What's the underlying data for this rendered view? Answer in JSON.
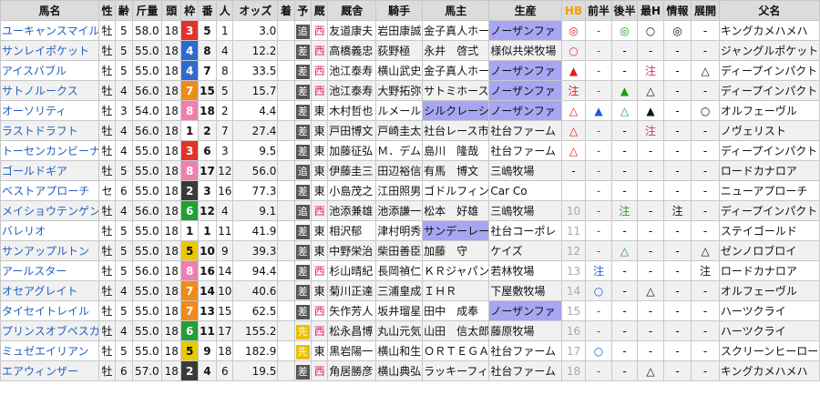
{
  "headers": [
    "馬名",
    "性",
    "齢",
    "斤量",
    "頭",
    "枠",
    "番",
    "人",
    "オッズ",
    "着",
    "予",
    "厩",
    "厩舎",
    "騎手",
    "馬主",
    "生産",
    "HB",
    "前半",
    "後半",
    "最H",
    "情報",
    "展開",
    "父名"
  ],
  "waku_colors": {
    "1": "#ffffff",
    "2": "#3a3a3a",
    "3": "#e2332b",
    "4": "#2e6ad0",
    "5": "#e9c900",
    "6": "#22a035",
    "7": "#f08a1a",
    "8": "#f07fb0"
  },
  "rows": [
    {
      "name": "ユーキャンスマイル",
      "sex": "牡",
      "age": "5",
      "weight": "58.0",
      "heads": "18",
      "waku": "3",
      "ban": "5",
      "pop": "1",
      "odds": "3.0",
      "chaku": "",
      "yoso": "追",
      "yoso_type": "t2",
      "ewest": "西",
      "trainer": "友道康夫",
      "jockey": "岩田康誠",
      "owner": "金子真人ホー",
      "owner_hl": false,
      "breeder": "ノーザンファ",
      "breeder_hl": true,
      "hb": "◎",
      "hb_c": "red",
      "front": "-",
      "back": "◎",
      "back_c": "grn",
      "maxh": "○",
      "maxh_c": "",
      "info": "◎",
      "info_c": "",
      "tenkai": "-",
      "sire": "キングカメハメハ"
    },
    {
      "name": "サンレイポケット",
      "sex": "牡",
      "age": "5",
      "weight": "55.0",
      "heads": "18",
      "waku": "4",
      "ban": "8",
      "pop": "4",
      "odds": "12.2",
      "chaku": "",
      "yoso": "差",
      "yoso_type": "t1",
      "ewest": "西",
      "trainer": "高橋義忠",
      "jockey": "荻野極",
      "owner": "永井　啓弍",
      "owner_hl": false,
      "breeder": "様似共栄牧場",
      "breeder_hl": false,
      "hb": "○",
      "hb_c": "pink",
      "front": "-",
      "back": "-",
      "back_c": "",
      "maxh": "-",
      "maxh_c": "",
      "info": "-",
      "info_c": "",
      "tenkai": "-",
      "sire": "ジャングルポケット"
    },
    {
      "name": "アイスバブル",
      "sex": "牡",
      "age": "5",
      "weight": "55.0",
      "heads": "18",
      "waku": "4",
      "ban": "7",
      "pop": "8",
      "odds": "33.5",
      "chaku": "",
      "yoso": "差",
      "yoso_type": "t1",
      "ewest": "西",
      "trainer": "池江泰寿",
      "jockey": "横山武史",
      "owner": "金子真人ホー",
      "owner_hl": false,
      "breeder": "ノーザンファ",
      "breeder_hl": true,
      "hb": "▲",
      "hb_c": "red",
      "front": "-",
      "back": "-",
      "back_c": "",
      "maxh": "注",
      "maxh_c": "pink",
      "info": "-",
      "info_c": "",
      "tenkai": "△",
      "sire": "ディープインパクト"
    },
    {
      "name": "サトノルークス",
      "sex": "牡",
      "age": "4",
      "weight": "56.0",
      "heads": "18",
      "waku": "7",
      "ban": "15",
      "pop": "5",
      "odds": "15.7",
      "chaku": "",
      "yoso": "差",
      "yoso_type": "t1",
      "ewest": "西",
      "trainer": "池江泰寿",
      "jockey": "大野拓弥",
      "owner": "サトミホース",
      "owner_hl": false,
      "breeder": "ノーザンファ",
      "breeder_hl": true,
      "hb": "注",
      "hb_c": "red",
      "front": "-",
      "back": "▲",
      "back_c": "grn",
      "maxh": "△",
      "maxh_c": "",
      "info": "-",
      "info_c": "",
      "tenkai": "-",
      "sire": "ディープインパクト"
    },
    {
      "name": "オーソリティ",
      "sex": "牡",
      "age": "3",
      "weight": "54.0",
      "heads": "18",
      "waku": "8",
      "ban": "18",
      "pop": "2",
      "odds": "4.4",
      "chaku": "",
      "yoso": "差",
      "yoso_type": "t1",
      "ewest": "東",
      "trainer": "木村哲也",
      "jockey": "ルメール",
      "owner": "シルクレーシ",
      "owner_hl": true,
      "breeder": "ノーザンファ",
      "breeder_hl": true,
      "hb": "△",
      "hb_c": "red",
      "front": "▲",
      "back": "△",
      "back_c": "grn",
      "maxh": "▲",
      "maxh_c": "",
      "info": "-",
      "info_c": "",
      "tenkai": "○",
      "sire": "オルフェーヴル"
    },
    {
      "name": "ラストドラフト",
      "sex": "牡",
      "age": "4",
      "weight": "56.0",
      "heads": "18",
      "waku": "1",
      "ban": "2",
      "pop": "7",
      "odds": "27.4",
      "chaku": "",
      "yoso": "差",
      "yoso_type": "t1",
      "ewest": "東",
      "trainer": "戸田博文",
      "jockey": "戸崎圭太",
      "owner": "社台レース市",
      "owner_hl": false,
      "breeder": "社台ファーム",
      "breeder_hl": false,
      "hb": "△",
      "hb_c": "red",
      "front": "-",
      "back": "-",
      "back_c": "",
      "maxh": "注",
      "maxh_c": "pink",
      "info": "-",
      "info_c": "",
      "tenkai": "-",
      "sire": "ノヴェリスト"
    },
    {
      "name": "トーセンカンビーナ",
      "sex": "牡",
      "age": "4",
      "weight": "55.0",
      "heads": "18",
      "waku": "3",
      "ban": "6",
      "pop": "3",
      "odds": "9.5",
      "chaku": "",
      "yoso": "差",
      "yoso_type": "t1",
      "ewest": "東",
      "trainer": "加藤征弘",
      "jockey": "Ｍ．デム",
      "owner": "島川　隆哉",
      "owner_hl": false,
      "breeder": "社台ファーム",
      "breeder_hl": false,
      "hb": "△",
      "hb_c": "red",
      "front": "-",
      "back": "-",
      "back_c": "",
      "maxh": "-",
      "maxh_c": "",
      "info": "-",
      "info_c": "",
      "tenkai": "-",
      "sire": "ディープインパクト"
    },
    {
      "name": "ゴールドギア",
      "sex": "牡",
      "age": "5",
      "weight": "55.0",
      "heads": "18",
      "waku": "8",
      "ban": "17",
      "pop": "12",
      "odds": "56.0",
      "chaku": "",
      "yoso": "追",
      "yoso_type": "t2",
      "ewest": "東",
      "trainer": "伊藤圭三",
      "jockey": "田辺裕信",
      "owner": "有馬　博文",
      "owner_hl": false,
      "breeder": "三嶋牧場",
      "breeder_hl": false,
      "hb": "-",
      "hb_c": "",
      "front": "-",
      "back": "-",
      "back_c": "",
      "maxh": "-",
      "maxh_c": "",
      "info": "-",
      "info_c": "",
      "tenkai": "-",
      "sire": "ロードカナロア"
    },
    {
      "name": "ベストアプローチ",
      "sex": "セ",
      "age": "6",
      "weight": "55.0",
      "heads": "18",
      "waku": "2",
      "ban": "3",
      "pop": "16",
      "odds": "77.3",
      "chaku": "",
      "yoso": "差",
      "yoso_type": "t1",
      "ewest": "東",
      "trainer": "小島茂之",
      "jockey": "江田照男",
      "owner": "ゴドルフィン",
      "owner_hl": false,
      "breeder": "Car Co",
      "breeder_hl": false,
      "hb": "",
      "hb_c": "",
      "front": "-",
      "back": "-",
      "back_c": "",
      "maxh": "-",
      "maxh_c": "",
      "info": "-",
      "info_c": "",
      "tenkai": "-",
      "sire": "ニューアプローチ"
    },
    {
      "name": "メイショウテンゲン",
      "sex": "牡",
      "age": "4",
      "weight": "56.0",
      "heads": "18",
      "waku": "6",
      "ban": "12",
      "pop": "4",
      "odds": "9.1",
      "chaku": "",
      "yoso": "追",
      "yoso_type": "t2",
      "ewest": "西",
      "trainer": "池添兼雄",
      "jockey": "池添謙一",
      "owner": "松本　好雄",
      "owner_hl": false,
      "breeder": "三嶋牧場",
      "breeder_hl": false,
      "hb": "10",
      "hb_c": "gray",
      "front": "-",
      "back": "注",
      "back_c": "grn",
      "maxh": "-",
      "maxh_c": "",
      "info": "注",
      "info_c": "",
      "tenkai": "-",
      "sire": "ディープインパクト",
      "sep": true
    },
    {
      "name": "バレリオ",
      "sex": "牡",
      "age": "5",
      "weight": "55.0",
      "heads": "18",
      "waku": "1",
      "ban": "1",
      "pop": "11",
      "odds": "41.9",
      "chaku": "",
      "yoso": "差",
      "yoso_type": "t1",
      "ewest": "東",
      "trainer": "相沢郁",
      "jockey": "津村明秀",
      "owner": "サンデーレー",
      "owner_hl": true,
      "breeder": "社台コーポレ",
      "breeder_hl": false,
      "hb": "11",
      "hb_c": "gray",
      "front": "-",
      "back": "-",
      "back_c": "",
      "maxh": "-",
      "maxh_c": "",
      "info": "-",
      "info_c": "",
      "tenkai": "-",
      "sire": "ステイゴールド"
    },
    {
      "name": "サンアップルトン",
      "sex": "牡",
      "age": "5",
      "weight": "55.0",
      "heads": "18",
      "waku": "5",
      "ban": "10",
      "pop": "9",
      "odds": "39.3",
      "chaku": "",
      "yoso": "差",
      "yoso_type": "t1",
      "ewest": "東",
      "trainer": "中野栄治",
      "jockey": "柴田善臣",
      "owner": "加藤　守",
      "owner_hl": false,
      "breeder": "ケイズ",
      "breeder_hl": false,
      "hb": "12",
      "hb_c": "gray",
      "front": "-",
      "back": "△",
      "back_c": "grn",
      "maxh": "-",
      "maxh_c": "",
      "info": "-",
      "info_c": "",
      "tenkai": "△",
      "sire": "ゼンノロブロイ"
    },
    {
      "name": "アールスター",
      "sex": "牡",
      "age": "5",
      "weight": "56.0",
      "heads": "18",
      "waku": "8",
      "ban": "16",
      "pop": "14",
      "odds": "94.4",
      "chaku": "",
      "yoso": "差",
      "yoso_type": "t1",
      "ewest": "西",
      "trainer": "杉山晴紀",
      "jockey": "長岡禎仁",
      "owner": "ＫＲジャパン",
      "owner_hl": false,
      "breeder": "若林牧場",
      "breeder_hl": false,
      "hb": "13",
      "hb_c": "gray",
      "front": "注",
      "back": "-",
      "back_c": "",
      "maxh": "-",
      "maxh_c": "",
      "info": "-",
      "info_c": "",
      "tenkai": "注",
      "sire": "ロードカナロア",
      "sep": true
    },
    {
      "name": "オセアグレイト",
      "sex": "牡",
      "age": "4",
      "weight": "55.0",
      "heads": "18",
      "waku": "7",
      "ban": "14",
      "pop": "10",
      "odds": "40.6",
      "chaku": "",
      "yoso": "差",
      "yoso_type": "t1",
      "ewest": "東",
      "trainer": "菊川正達",
      "jockey": "三浦皇成",
      "owner": "ＩＨＲ",
      "owner_hl": false,
      "breeder": "下屋敷牧場",
      "breeder_hl": false,
      "hb": "14",
      "hb_c": "gray",
      "front": "○",
      "back": "-",
      "back_c": "",
      "maxh": "△",
      "maxh_c": "",
      "info": "-",
      "info_c": "",
      "tenkai": "-",
      "sire": "オルフェーヴル"
    },
    {
      "name": "タイセイトレイル",
      "sex": "牡",
      "age": "5",
      "weight": "55.0",
      "heads": "18",
      "waku": "7",
      "ban": "13",
      "pop": "15",
      "odds": "62.5",
      "chaku": "",
      "yoso": "差",
      "yoso_type": "t1",
      "ewest": "西",
      "trainer": "矢作芳人",
      "jockey": "坂井瑠星",
      "owner": "田中　成奉",
      "owner_hl": false,
      "breeder": "ノーザンファ",
      "breeder_hl": true,
      "hb": "15",
      "hb_c": "gray",
      "front": "-",
      "back": "-",
      "back_c": "",
      "maxh": "-",
      "maxh_c": "",
      "info": "-",
      "info_c": "",
      "tenkai": "-",
      "sire": "ハーツクライ"
    },
    {
      "name": "プリンスオブペスカ",
      "sex": "牡",
      "age": "4",
      "weight": "55.0",
      "heads": "18",
      "waku": "6",
      "ban": "11",
      "pop": "17",
      "odds": "155.2",
      "chaku": "",
      "yoso": "先",
      "yoso_type": "t3",
      "ewest": "西",
      "trainer": "松永昌博",
      "jockey": "丸山元気",
      "owner": "山田　信太郎",
      "owner_hl": false,
      "breeder": "藤原牧場",
      "breeder_hl": false,
      "hb": "16",
      "hb_c": "gray",
      "front": "-",
      "back": "-",
      "back_c": "",
      "maxh": "-",
      "maxh_c": "",
      "info": "-",
      "info_c": "",
      "tenkai": "-",
      "sire": "ハーツクライ"
    },
    {
      "name": "ミュゼエイリアン",
      "sex": "牡",
      "age": "5",
      "weight": "55.0",
      "heads": "18",
      "waku": "5",
      "ban": "9",
      "pop": "18",
      "odds": "182.9",
      "chaku": "",
      "yoso": "先",
      "yoso_type": "t3",
      "ewest": "東",
      "trainer": "黒岩陽一",
      "jockey": "横山和生",
      "owner": "ＯＲＴＥＧＡ",
      "owner_hl": false,
      "breeder": "社台ファーム",
      "breeder_hl": false,
      "hb": "17",
      "hb_c": "gray",
      "front": "○",
      "back": "-",
      "back_c": "",
      "maxh": "-",
      "maxh_c": "",
      "info": "-",
      "info_c": "",
      "tenkai": "-",
      "sire": "スクリーンヒーロー"
    },
    {
      "name": "エアウィンザー",
      "sex": "牡",
      "age": "6",
      "weight": "57.0",
      "heads": "18",
      "waku": "2",
      "ban": "4",
      "pop": "6",
      "odds": "19.5",
      "chaku": "",
      "yoso": "差",
      "yoso_type": "t1",
      "ewest": "西",
      "trainer": "角居勝彦",
      "jockey": "横山典弘",
      "owner": "ラッキーフィ",
      "owner_hl": false,
      "breeder": "社台ファーム",
      "breeder_hl": false,
      "hb": "18",
      "hb_c": "gray",
      "front": "-",
      "back": "-",
      "back_c": "",
      "maxh": "△",
      "maxh_c": "",
      "info": "-",
      "info_c": "",
      "tenkai": "-",
      "sire": "キングカメハメハ"
    }
  ]
}
